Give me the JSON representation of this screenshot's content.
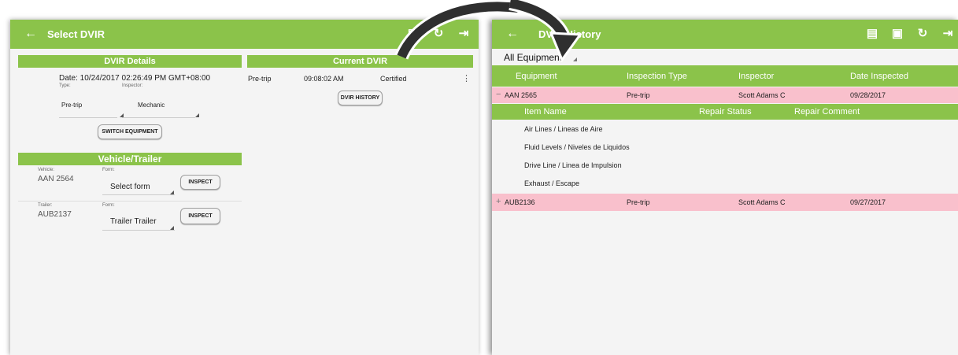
{
  "left_screen": {
    "title": "Select DVIR",
    "details_header": "DVIR Details",
    "current_header": "Current DVIR",
    "date_text": "Date: 10/24/2017 02:26:49 PM GMT+08:00",
    "type_label": "Type:",
    "inspector_label": "Inspector:",
    "type_value": "Pre-trip",
    "inspector_value": "Mechanic",
    "switch_button": "SWITCH EQUIPMENT",
    "current": {
      "type": "Pre-trip",
      "time": "09:08:02 AM",
      "status": "Certified",
      "more_icon": "more-vertical-icon"
    },
    "history_button": "DVIR HISTORY",
    "vehicle_header": "Vehicle/Trailer",
    "vehicle_label": "Vehicle:",
    "vehicle_value": "AAN 2564",
    "form_label_1": "Form:",
    "form_value_1": "Select form",
    "inspect_1": "INSPECT",
    "trailer_label": "Trailer:",
    "trailer_value": "AUB2137",
    "form_label_2": "Form:",
    "form_value_2": "Trailer Trailer",
    "inspect_2": "INSPECT"
  },
  "right_screen": {
    "title": "DVIR History",
    "filter_value": "All Equipment",
    "columns": [
      "Equipment",
      "Inspection Type",
      "Inspector",
      "Date Inspected"
    ],
    "rows": [
      {
        "toggle": "−",
        "equipment": "AAN 2565",
        "type": "Pre-trip",
        "inspector": "Scott Adams C",
        "date": "09/28/2017"
      },
      {
        "toggle": "+",
        "equipment": "AUB2136",
        "type": "Pre-trip",
        "inspector": "Scott Adams C",
        "date": "09/27/2017"
      }
    ],
    "item_columns": [
      "Item Name",
      "Repair Status",
      "Repair Comment"
    ],
    "items": [
      "Air Lines / Lineas de Aire",
      "Fluid Levels / Niveles de Liquidos",
      "Drive Line / Linea de Impulsion",
      "Exhaust / Escape"
    ]
  },
  "icons": {
    "back": "arrow-left-icon",
    "message": "message-icon",
    "equipment": "equipment-icon",
    "refresh": "refresh-icon",
    "logout": "logout-icon"
  },
  "colors": {
    "accent": "#8bc34a",
    "highlight_row": "#f9c0cc",
    "arrow": "#2f2f2f"
  }
}
